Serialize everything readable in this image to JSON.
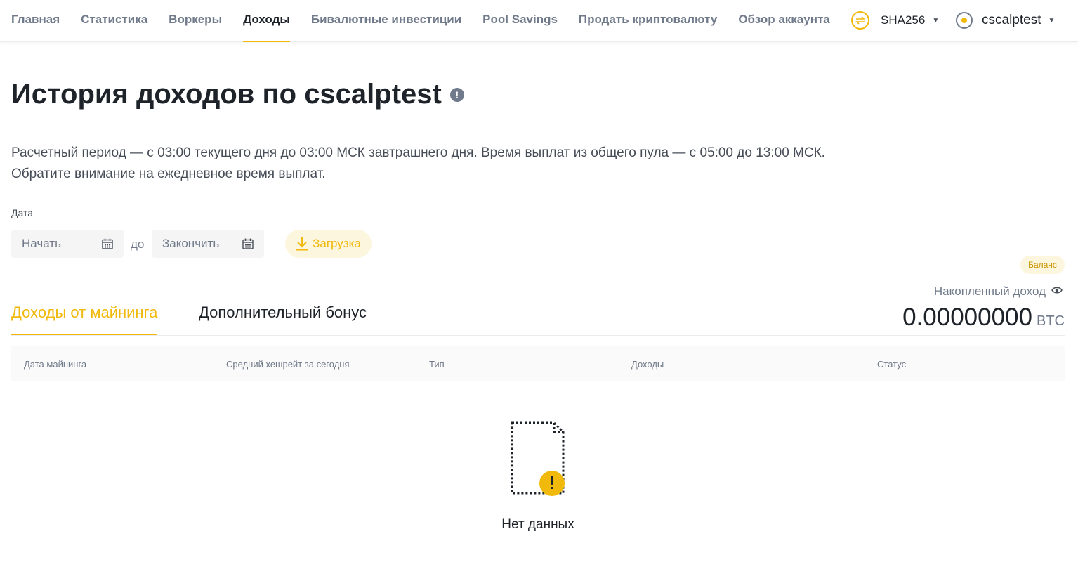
{
  "nav": {
    "items": [
      {
        "label": "Главная"
      },
      {
        "label": "Статистика"
      },
      {
        "label": "Воркеры"
      },
      {
        "label": "Доходы",
        "active": true
      },
      {
        "label": "Бивалютные инвестиции"
      },
      {
        "label": "Pool Savings"
      },
      {
        "label": "Продать криптовалюту"
      },
      {
        "label": "Обзор аккаунта"
      }
    ],
    "algorithm": "SHA256",
    "account": "cscalptest"
  },
  "page": {
    "title": "История доходов по cscalptest",
    "description_line1": "Расчетный период — с 03:00 текущего дня до 03:00 МСК завтрашнего дня. Время выплат из общего пула — с 05:00 до 13:00 МСК.",
    "description_line2": "Обратите внимание на ежедневное время выплат."
  },
  "filter": {
    "date_label": "Дата",
    "start_placeholder": "Начать",
    "separator": "до",
    "end_placeholder": "Закончить",
    "download_label": "Загрузка"
  },
  "balance": {
    "badge": "Баланс",
    "label": "Накопленный доход",
    "value": "0.00000000",
    "unit": "BTC"
  },
  "tabs": [
    {
      "label": "Доходы от майнинга",
      "active": true
    },
    {
      "label": "Дополнительный бонус",
      "active": false
    }
  ],
  "table": {
    "columns": [
      "Дата майнинга",
      "Средний хешрейт за сегодня",
      "Тип",
      "Доходы",
      "Статус"
    ],
    "rows": [],
    "empty_text": "Нет данных"
  },
  "colors": {
    "accent": "#f0b90b",
    "text_primary": "#1e2329",
    "text_secondary": "#707a8a"
  }
}
